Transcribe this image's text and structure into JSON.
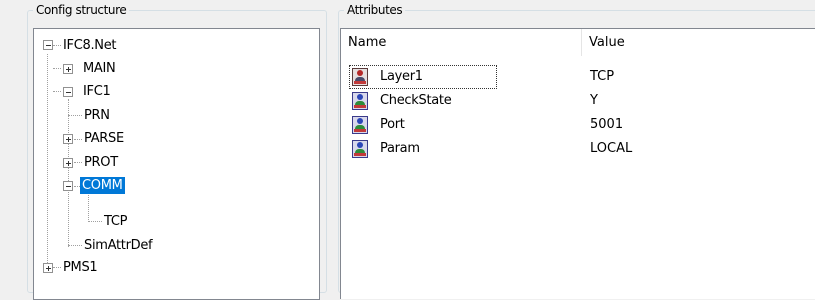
{
  "config_panel": {
    "title": "Config structure"
  },
  "tree": {
    "root": {
      "label": "IFC8.Net"
    },
    "main": {
      "label": "MAIN"
    },
    "ifc1": {
      "label": "IFC1"
    },
    "prn": {
      "label": "PRN"
    },
    "parse": {
      "label": "PARSE"
    },
    "prot": {
      "label": "PROT"
    },
    "comm": {
      "label": "COMM",
      "selected": true
    },
    "tcp": {
      "label": "TCP"
    },
    "simattrdef": {
      "label": "SimAttrDef"
    },
    "pms1": {
      "label": "PMS1"
    }
  },
  "attributes_panel": {
    "title": "Attributes",
    "columns": {
      "name": "Name",
      "value": "Value"
    },
    "rows": [
      {
        "name": "Layer1",
        "value": "TCP",
        "icon": "user-attribute-icon",
        "focused": true
      },
      {
        "name": "CheckState",
        "value": "Y",
        "icon": "attribute-icon"
      },
      {
        "name": "Port",
        "value": "5001",
        "icon": "attribute-icon"
      },
      {
        "name": "Param",
        "value": "LOCAL",
        "icon": "attribute-icon"
      }
    ]
  },
  "colors": {
    "selection": "#0078d7",
    "border": "#828790"
  }
}
